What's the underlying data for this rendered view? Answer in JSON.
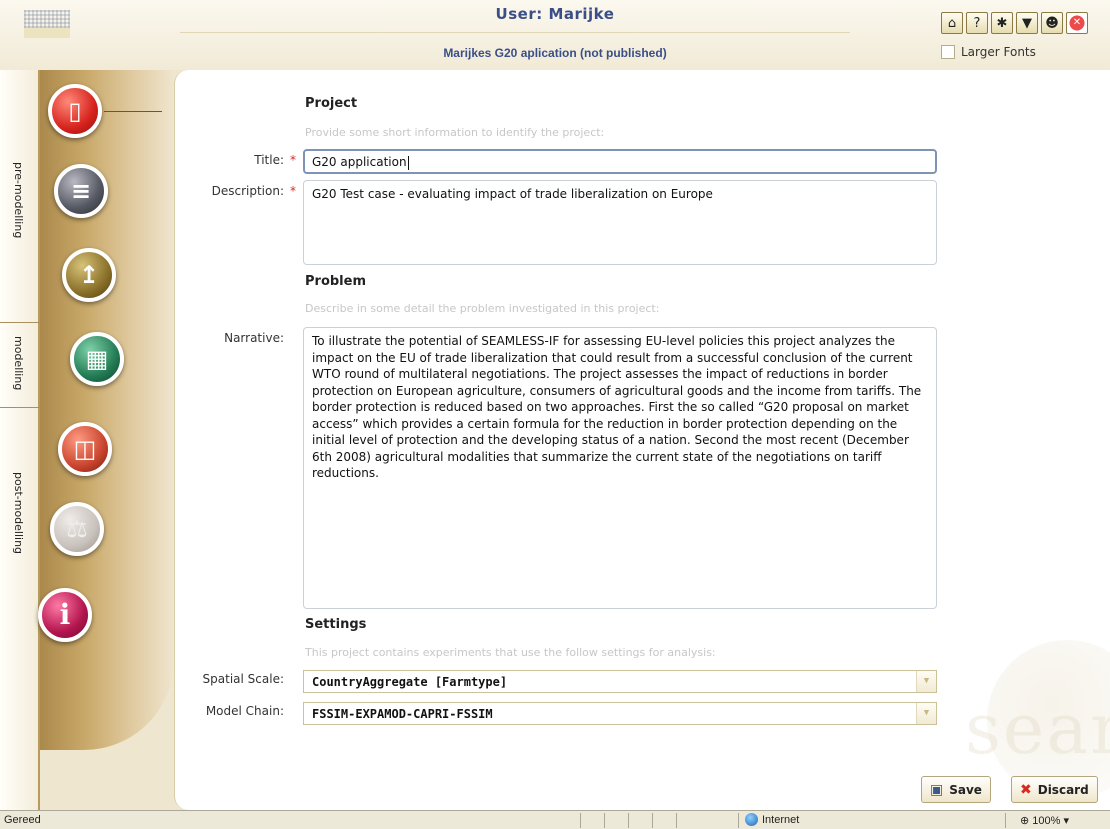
{
  "header": {
    "user_title": "User: Marijke",
    "project_subtitle": "Marijkes G20 aplication (not published)",
    "larger_fonts_label": "Larger Fonts",
    "icons": [
      "home-icon",
      "help-icon",
      "bug-icon",
      "tools-icon",
      "users-icon",
      "close-icon"
    ]
  },
  "sidebar": {
    "sections": [
      {
        "label": "pre-modelling"
      },
      {
        "label": "modelling"
      },
      {
        "label": "post-modelling"
      }
    ],
    "items": [
      "project-icon",
      "books-icon",
      "thermometer-icon",
      "calculator-icon",
      "chart-icon",
      "scale-icon",
      "info-icon"
    ]
  },
  "form": {
    "project": {
      "heading": "Project",
      "hint": "Provide some short information to identify the project:",
      "title_label": "Title:",
      "title_value": "G20 application",
      "description_label": "Description:",
      "description_value": "G20 Test case - evaluating impact of trade liberalization on Europe",
      "required_marker": "*"
    },
    "problem": {
      "heading": "Problem",
      "hint": "Describe in some detail the problem investigated in this project:",
      "narrative_label": "Narrative:",
      "narrative_value": "To illustrate the potential of SEAMLESS-IF for assessing EU-level policies this project analyzes the impact on the EU of trade liberalization that could result from a successful conclusion of the current WTO round of multilateral negotiations. The project assesses the impact of reductions in border protection on European agriculture, consumers of agricultural goods and the income from tariffs. The border protection is reduced based on two approaches. First the so called “G20 proposal on market access” which provides a certain formula for the reduction in border protection depending on the initial level of protection and the developing status of a nation. Second the most recent (December 6th 2008) agricultural modalities that summarize the current state of the negotiations on tariff reductions."
    },
    "settings": {
      "heading": "Settings",
      "hint": "This project contains experiments that use the follow settings for analysis:",
      "spatial_scale_label": "Spatial Scale:",
      "spatial_scale_value": "CountryAggregate [Farmtype]",
      "model_chain_label": "Model Chain:",
      "model_chain_value": "FSSIM-EXPAMOD-CAPRI-FSSIM"
    }
  },
  "actions": {
    "save_label": "Save",
    "discard_label": "Discard"
  },
  "watermark": "seamless",
  "statusbar": {
    "status": "Gereed",
    "zone": "Internet",
    "zoom": "100%"
  }
}
